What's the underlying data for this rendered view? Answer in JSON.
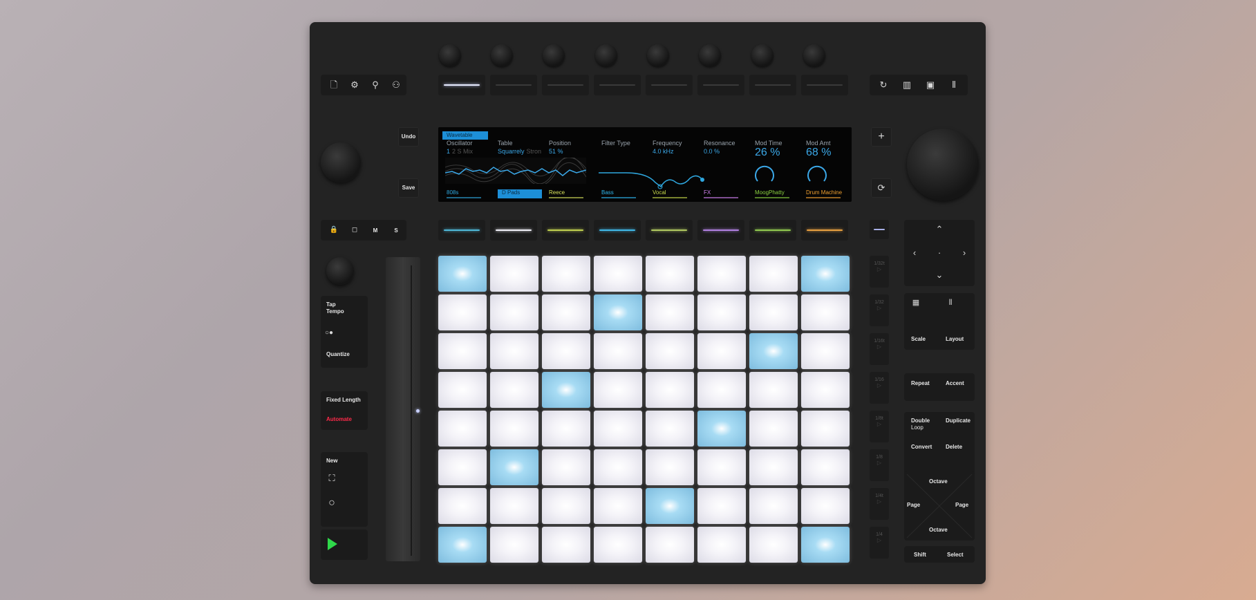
{
  "left": {
    "top_icons": [
      "new-file-icon",
      "settings-gear-icon",
      "location-pin-icon",
      "user-icon"
    ],
    "undo": "Undo",
    "save": "Save",
    "track_icons": [
      "lock-icon",
      "square-icon"
    ],
    "track_labels": [
      "M",
      "S"
    ],
    "tap": "Tap",
    "tempo": "Tempo",
    "quantize": "Quantize",
    "fixed_length": "Fixed Length",
    "automate": "Automate",
    "new": "New"
  },
  "right": {
    "top_icons": [
      "loop-icon",
      "mixer-icon",
      "clip-icon",
      "columns-icon"
    ],
    "add": "+",
    "scale": "Scale",
    "layout": "Layout",
    "repeat": "Repeat",
    "accent": "Accent",
    "double": "Double",
    "loop": "Loop",
    "duplicate": "Duplicate",
    "convert": "Convert",
    "delete": "Delete",
    "octave_up": "Octave",
    "octave_down": "Octave",
    "page_left": "Page",
    "page_right": "Page",
    "shift": "Shift",
    "select": "Select",
    "scene_labels": [
      "1/32t",
      "1/32",
      "1/16t",
      "1/16",
      "1/8t",
      "1/8",
      "1/4t",
      "1/4"
    ]
  },
  "display": {
    "tab": "Wavetable",
    "params": [
      {
        "label": "Oscillator",
        "value": "1",
        "sub": "2 S Mix"
      },
      {
        "label": "Table",
        "value": "Squarrely",
        "sub": "Stron"
      },
      {
        "label": "Position",
        "value": "51 %"
      },
      {
        "label": "Filter Type",
        "value": ""
      },
      {
        "label": "Frequency",
        "value": "4.0 kHz"
      },
      {
        "label": "Resonance",
        "value": "0.0 %"
      },
      {
        "label": "Mod Time",
        "value": "26 %"
      },
      {
        "label": "Mod Amt",
        "value": "68 %"
      }
    ],
    "tracks": [
      {
        "name": "808s",
        "color": "#2fa8e0"
      },
      {
        "name": "D Pads",
        "color": "#1d8fd8"
      },
      {
        "name": "Reece",
        "color": "#d6e05a"
      },
      {
        "name": "Bass",
        "color": "#2fb8f0"
      },
      {
        "name": "Vocal",
        "color": "#c6d84a"
      },
      {
        "name": "FX",
        "color": "#d080f0"
      },
      {
        "name": "MoogPhatty",
        "color": "#8ad040"
      },
      {
        "name": "Drum Machine",
        "color": "#f0a030"
      }
    ]
  },
  "colors": {
    "automate": "#ff2a4a",
    "play": "#2fd84a",
    "accent_blue": "#3ba8e8",
    "lower_strip": [
      "#4fb8d8",
      "#f0f0f8",
      "#c0d050",
      "#40b8e8",
      "#b0c860",
      "#b080e0",
      "#90c850",
      "#e8a040"
    ]
  },
  "grid": {
    "rows": [
      [
        1,
        0,
        0,
        0,
        0,
        0,
        0,
        1
      ],
      [
        0,
        0,
        0,
        1,
        0,
        0,
        0,
        0
      ],
      [
        0,
        0,
        0,
        0,
        0,
        0,
        1,
        0
      ],
      [
        0,
        0,
        1,
        0,
        0,
        0,
        0,
        0
      ],
      [
        0,
        0,
        0,
        0,
        0,
        1,
        0,
        0
      ],
      [
        0,
        1,
        0,
        0,
        0,
        0,
        0,
        0
      ],
      [
        0,
        0,
        0,
        0,
        1,
        0,
        0,
        0
      ],
      [
        1,
        0,
        0,
        0,
        0,
        0,
        0,
        1
      ]
    ]
  }
}
